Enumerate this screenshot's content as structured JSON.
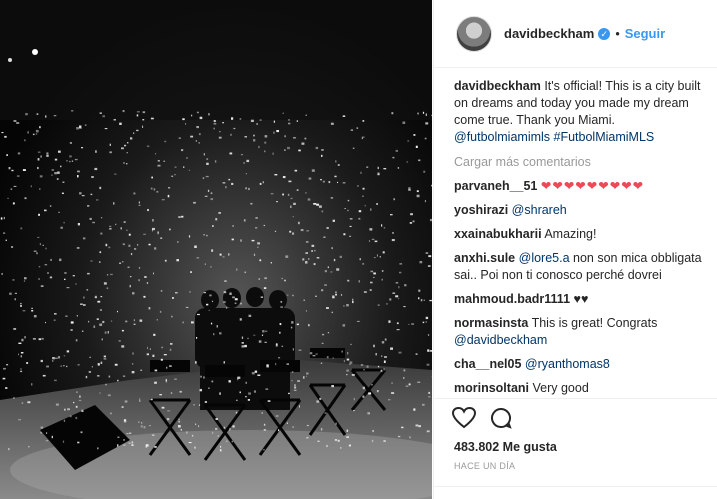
{
  "header": {
    "username": "davidbeckham",
    "verified_icon": "verified-check-icon",
    "separator": "•",
    "follow_label": "Seguir"
  },
  "caption": {
    "username": "davidbeckham",
    "text": "It's official! This is a city built on dreams and today you made my dream come true. Thank you Miami.",
    "tags": "@futbolmiamimls #FutbolMiamiMLS"
  },
  "load_more_label": "Cargar más comentarios",
  "comments": [
    {
      "user": "parvaneh__51",
      "mention": "",
      "text": "",
      "hearts": "❤❤❤❤❤❤❤❤❤"
    },
    {
      "user": "yoshirazi",
      "mention": "@shrareh",
      "text": "",
      "hearts": ""
    },
    {
      "user": "xxainabukharii",
      "mention": "",
      "text": "Amazing!",
      "hearts": ""
    },
    {
      "user": "anxhi.sule",
      "mention": "@lore5.a",
      "text": "non son mica obbligata sai.. Poi non ti conosco perché dovrei",
      "hearts": ""
    },
    {
      "user": "mahmoud.badr1111",
      "mention": "",
      "text": "",
      "hearts": "♥♥"
    },
    {
      "user": "normasinsta",
      "mention": "",
      "text": "This is great! Congrats",
      "mention_after": "@davidbeckham",
      "hearts": ""
    },
    {
      "user": "cha__nel05",
      "mention": "@ryanthomas8",
      "text": "",
      "hearts": ""
    },
    {
      "user": "morinsoltani",
      "mention": "",
      "text": "Very good",
      "hearts": ""
    }
  ],
  "actions": {
    "like_icon": "heart-outline-icon",
    "comment_icon": "speech-bubble-icon",
    "likes_text": "483.802 Me gusta",
    "time_text": "HACE UN DÍA"
  },
  "colors": {
    "link": "#003569",
    "follow": "#3897f0",
    "muted": "#999999",
    "text": "#262626"
  }
}
